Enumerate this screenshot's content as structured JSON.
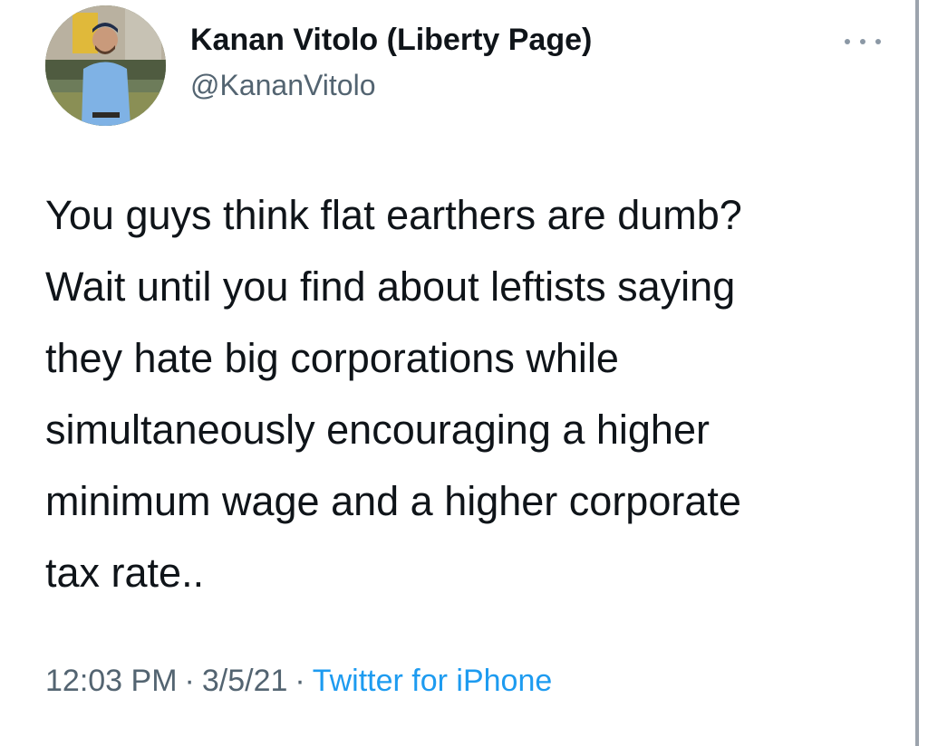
{
  "tweet": {
    "author": {
      "display_name": "Kanan Vitolo (Liberty Page)",
      "handle": "@KananVitolo",
      "avatar_icon": "profile-photo"
    },
    "more_icon": "more-horizontal-icon",
    "text": "You guys think flat earthers are dumb?\nWait until you find about leftists saying\nthey hate big corporations while\nsimultaneously encouraging a higher\nminimum wage and a higher corporate\ntax rate..",
    "time": "12:03 PM",
    "separator": "·",
    "date": "3/5/21",
    "source": "Twitter for iPhone"
  },
  "colors": {
    "text": "#0f1419",
    "secondary": "#536471",
    "link": "#1d9bf0",
    "background": "#ffffff"
  }
}
